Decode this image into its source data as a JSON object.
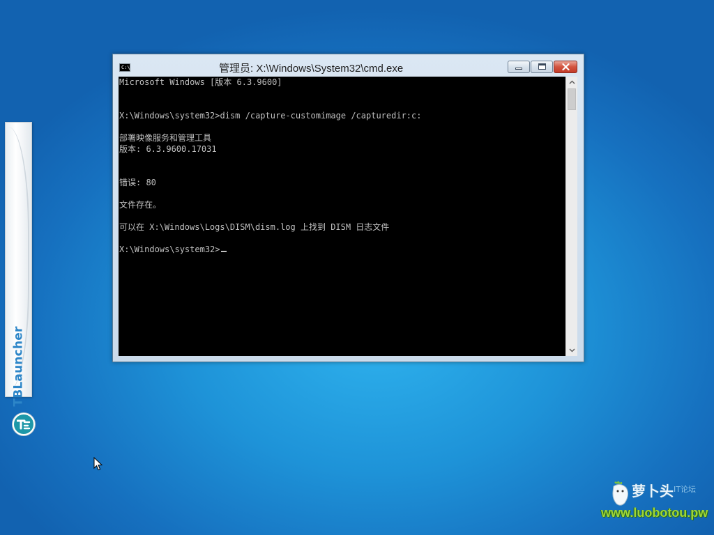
{
  "desktop": {
    "background_color": "#1e93d8"
  },
  "launcher": {
    "name": "TBLauncher",
    "logo_icon": "tblauncher-logo-icon",
    "accent_color": "#2d86c8"
  },
  "window": {
    "title": "管理员: X:\\Windows\\System32\\cmd.exe",
    "icon": "cmd-icon",
    "icon_text": "C:\\",
    "controls": {
      "minimize_icon": "minimize-icon",
      "maximize_icon": "maximize-icon",
      "close_icon": "close-icon"
    }
  },
  "console": {
    "background_color": "#000000",
    "text_color": "#c0c0c0",
    "lines": [
      "Microsoft Windows [版本 6.3.9600]",
      "",
      "",
      "X:\\Windows\\system32>dism /capture-customimage /capturedir:c:",
      "",
      "部署映像服务和管理工具",
      "版本: 6.3.9600.17031",
      "",
      "",
      "错误: 80",
      "",
      "文件存在。",
      "",
      "可以在 X:\\Windows\\Logs\\DISM\\dism.log 上找到 DISM 日志文件",
      "",
      "X:\\Windows\\system32>"
    ]
  },
  "watermark": {
    "cn_text": "萝卜头",
    "forum_text": "IT论坛",
    "url": "www.luobotou.pw"
  }
}
